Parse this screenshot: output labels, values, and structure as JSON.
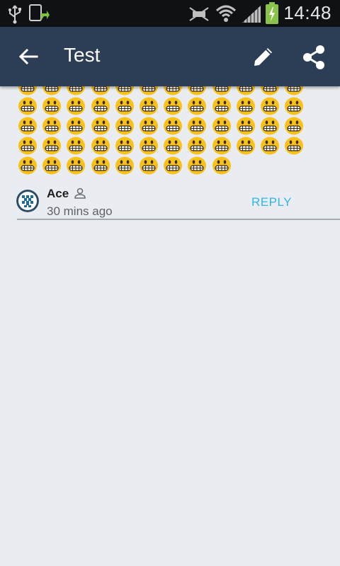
{
  "statusbar": {
    "time": "14:48",
    "icons": [
      "usb-icon",
      "screenshot-upload-icon",
      "mute-icon",
      "wifi-icon",
      "signal-icon",
      "battery-charging-icon"
    ]
  },
  "appbar": {
    "title": "Test",
    "icons": [
      "back-arrow-icon",
      "edit-pencil-icon",
      "share-icon"
    ],
    "color": "#2c3e55"
  },
  "post": {
    "emoji": "grinning-face",
    "rows": [
      12,
      12,
      12,
      12,
      9
    ],
    "emoji_color": "#f9c21b"
  },
  "comment": {
    "author": "Ace",
    "time": "30 mins ago",
    "reply_label": "REPLY",
    "reply_color": "#33b5e5"
  },
  "background": "#e9edf1"
}
